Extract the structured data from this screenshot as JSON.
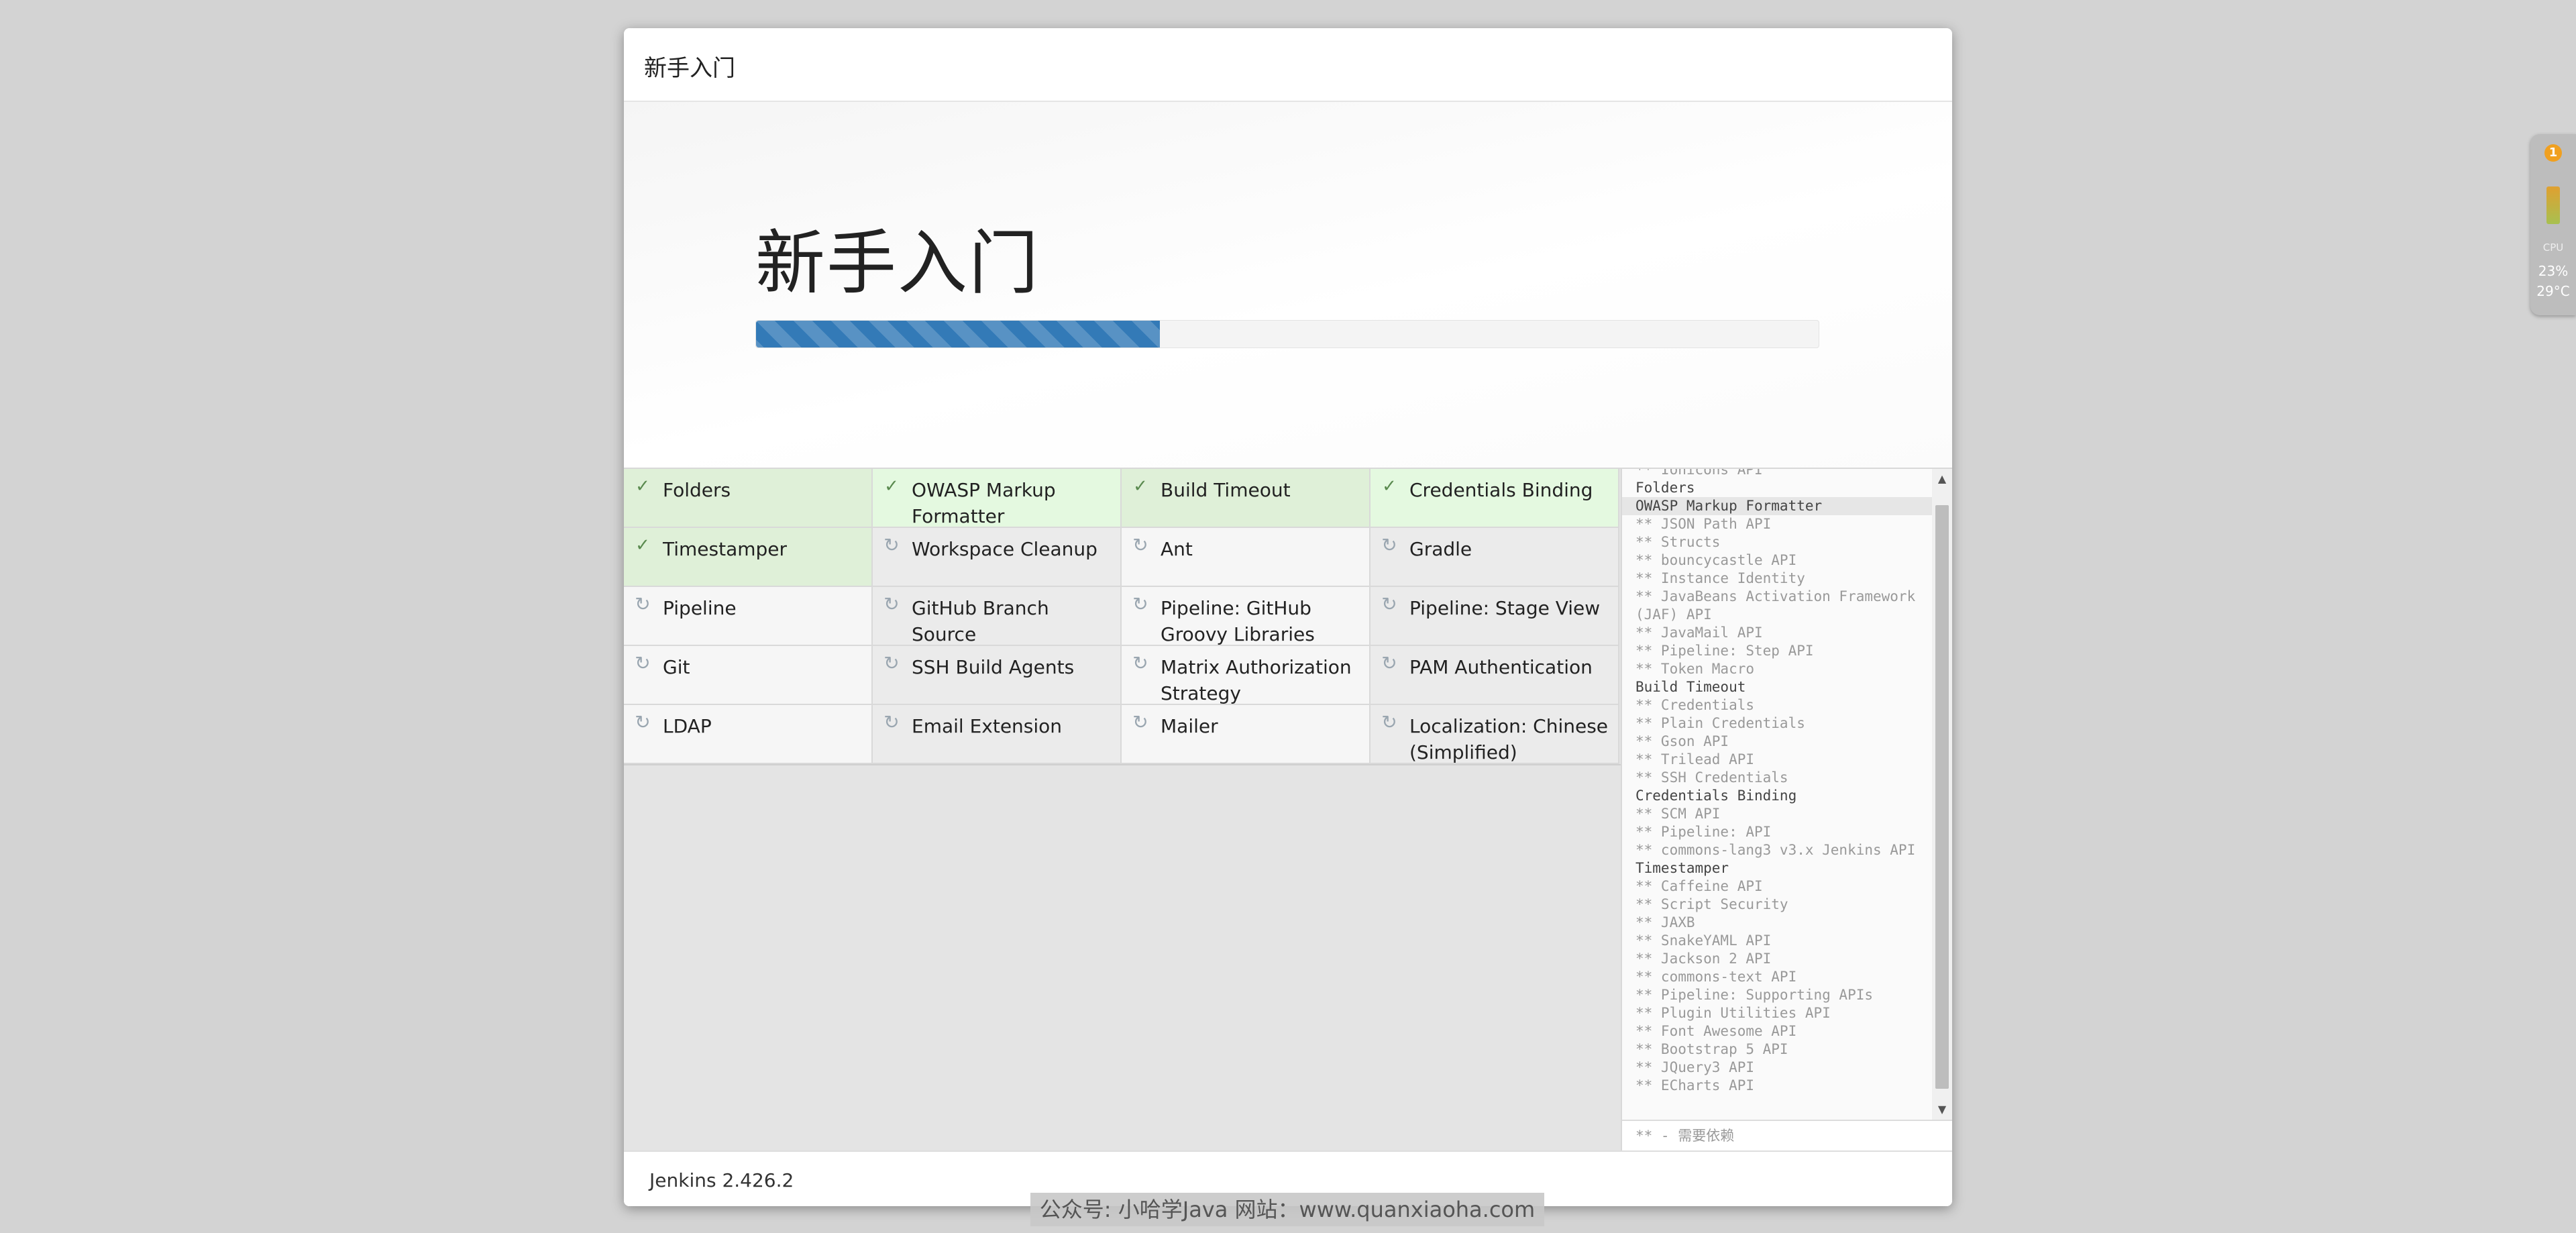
{
  "modal": {
    "header_title": "新手入门",
    "hero_title": "新手入门",
    "progress_percent": 38
  },
  "plugins": [
    {
      "name": "Folders",
      "status": "success"
    },
    {
      "name": "OWASP Markup Formatter",
      "status": "success"
    },
    {
      "name": "Build Timeout",
      "status": "success"
    },
    {
      "name": "Credentials Binding",
      "status": "success"
    },
    {
      "name": "Timestamper",
      "status": "success"
    },
    {
      "name": "Workspace Cleanup",
      "status": "pending"
    },
    {
      "name": "Ant",
      "status": "pending"
    },
    {
      "name": "Gradle",
      "status": "pending"
    },
    {
      "name": "Pipeline",
      "status": "pending"
    },
    {
      "name": "GitHub Branch Source",
      "status": "pending"
    },
    {
      "name": "Pipeline: GitHub Groovy Libraries",
      "status": "pending"
    },
    {
      "name": "Pipeline: Stage View",
      "status": "pending"
    },
    {
      "name": "Git",
      "status": "pending"
    },
    {
      "name": "SSH Build Agents",
      "status": "pending"
    },
    {
      "name": "Matrix Authorization Strategy",
      "status": "pending"
    },
    {
      "name": "PAM Authentication",
      "status": "pending"
    },
    {
      "name": "LDAP",
      "status": "pending"
    },
    {
      "name": "Email Extension",
      "status": "pending"
    },
    {
      "name": "Mailer",
      "status": "pending"
    },
    {
      "name": "Localization: Chinese (Simplified)",
      "status": "pending"
    }
  ],
  "log": {
    "lines": [
      "** Ionicons API",
      "Folders",
      "OWASP Markup Formatter",
      "** JSON Path API",
      "** Structs",
      "** bouncycastle API",
      "** Instance Identity",
      "** JavaBeans Activation Framework (JAF) API",
      "** JavaMail API",
      "** Pipeline: Step API",
      "** Token Macro",
      "Build Timeout",
      "** Credentials",
      "** Plain Credentials",
      "** Gson API",
      "** Trilead API",
      "** SSH Credentials",
      "Credentials Binding",
      "** SCM API",
      "** Pipeline: API",
      "** commons-lang3 v3.x Jenkins API",
      "Timestamper",
      "** Caffeine API",
      "** Script Security",
      "** JAXB",
      "** SnakeYAML API",
      "** Jackson 2 API",
      "** commons-text API",
      "** Pipeline: Supporting APIs",
      "** Plugin Utilities API",
      "** Font Awesome API",
      "** Bootstrap 5 API",
      "** JQuery3 API",
      "** ECharts API"
    ],
    "current_line": "OWASP Markup Formatter",
    "legend": "** - 需要依赖"
  },
  "footer": {
    "version": "Jenkins 2.426.2"
  },
  "watermark": "公众号: 小哈学Java  网站：www.quanxiaoha.com",
  "cpu_widget": {
    "badge": "1",
    "label": "CPU",
    "usage": "23%",
    "temp": "29°C"
  },
  "icons": {
    "success": "check-icon",
    "pending": "spinner-icon"
  },
  "colors": {
    "success_bg": "#dff0d8",
    "progress": "#337ab7"
  }
}
